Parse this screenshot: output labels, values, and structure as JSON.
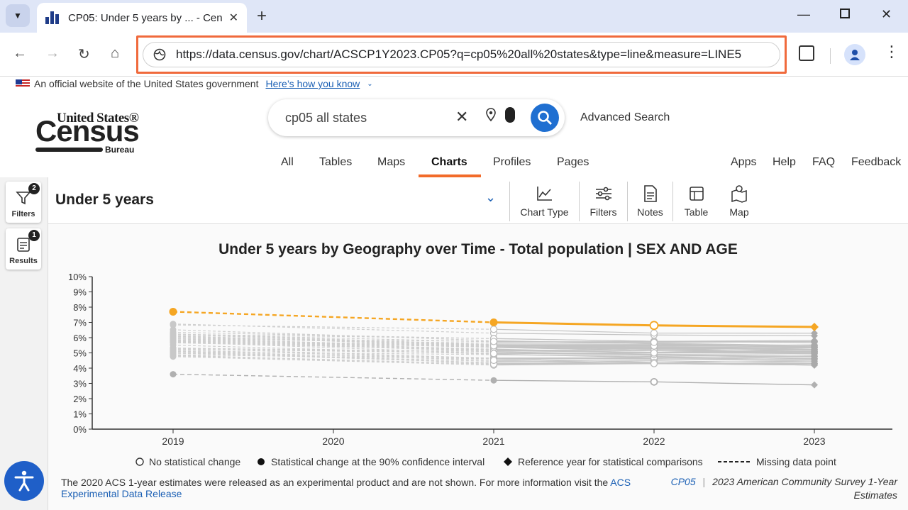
{
  "browser": {
    "tab_title": "CP05: Under 5 years by ... - Cen",
    "url": "https://data.census.gov/chart/ACSCP1Y2023.CP05?q=cp05%20all%20states&type=line&measure=LINE5"
  },
  "gov_banner": {
    "text": "An official website of the United States government",
    "link": "Here’s how you know"
  },
  "logo": {
    "line1": "United States®",
    "line2": "Census",
    "line3": "Bureau"
  },
  "search": {
    "value": "cp05 all states",
    "advanced": "Advanced Search"
  },
  "nav": {
    "tabs": [
      "All",
      "Tables",
      "Maps",
      "Charts",
      "Profiles",
      "Pages"
    ],
    "active": "Charts",
    "right": [
      "Apps",
      "Help",
      "FAQ",
      "Feedback"
    ]
  },
  "sidebar": {
    "filters": {
      "label": "Filters",
      "badge": "2"
    },
    "results": {
      "label": "Results",
      "badge": "1"
    }
  },
  "toolbar": {
    "measure": "Under 5 years",
    "tools": [
      "Chart Type",
      "Filters",
      "Notes",
      "Table",
      "Map"
    ]
  },
  "colors": {
    "highlight": "#f5a623",
    "gray": "#b8b8b8",
    "link": "#1a5fb4",
    "accent": "#f26b2a"
  },
  "chart_data": {
    "type": "line",
    "title": "Under 5 years by Geography over Time - Total population | SEX AND AGE",
    "x": [
      "2019",
      "2020",
      "2021",
      "2022",
      "2023"
    ],
    "ylim": [
      0,
      10
    ],
    "yticks": [
      "0%",
      "1%",
      "2%",
      "3%",
      "4%",
      "5%",
      "6%",
      "7%",
      "8%",
      "9%",
      "10%"
    ],
    "highlight_series": {
      "values": [
        7.7,
        null,
        7.0,
        6.8,
        6.7
      ]
    },
    "low_series": {
      "values": [
        3.6,
        null,
        3.2,
        3.1,
        2.9
      ]
    },
    "legend": [
      "No statistical change",
      "Statistical change at the 90% confidence interval",
      "Reference year for statistical comparisons",
      "Missing data point"
    ]
  },
  "footer": {
    "note": "The 2020 ACS 1-year estimates were released as an experimental product and are not shown. For more information visit the ",
    "note_link": "ACS Experimental Data Release",
    "source_code": "CP05",
    "source_text": "2023 American Community Survey 1-Year Estimates"
  }
}
